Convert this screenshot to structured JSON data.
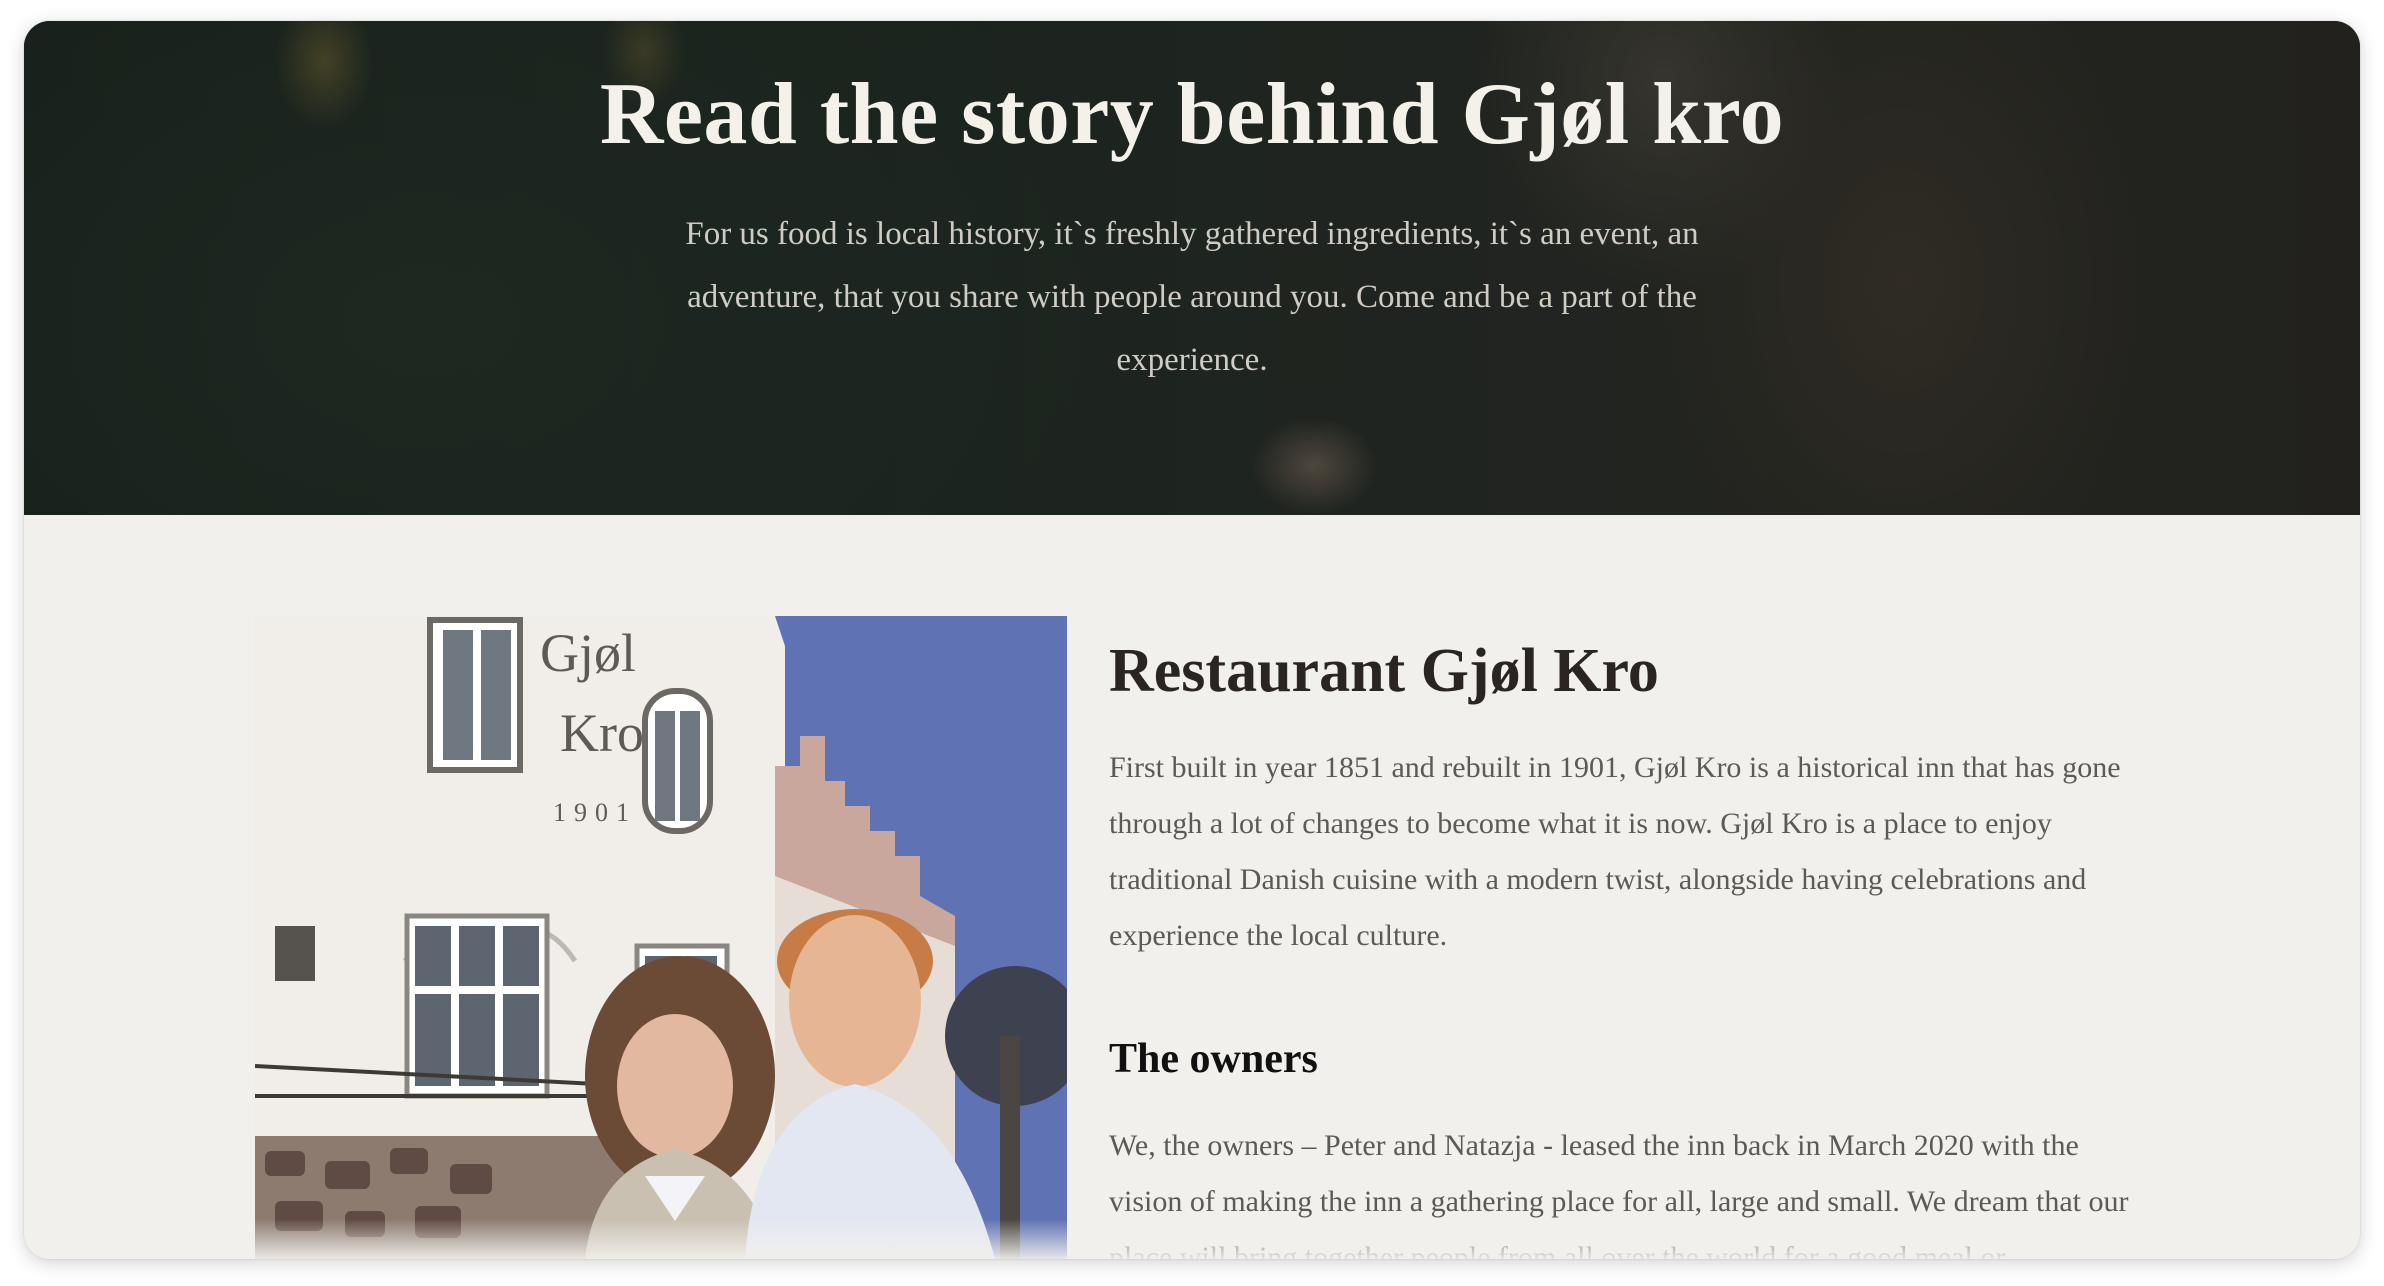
{
  "hero": {
    "title": "Read the story behind Gjøl kro",
    "text": "For us food is local history, it`s freshly gathered ingredients, it`s an event, an adventure, that you share with people around you. Come and be a part of the experience."
  },
  "about": {
    "heading": "Restaurant Gjøl Kro",
    "paragraph": "First built in year 1851 and rebuilt in 1901, Gjøl Kro is a historical inn that has gone through a lot of changes to become what it is now. Gjøl Kro is a place to enjoy traditional Danish cuisine with a modern twist, alongside having celebrations and experience the local culture.",
    "owners_heading": "The owners",
    "owners_paragraph": "We, the owners – Peter and Natazja - leased the inn back in March 2020 with the vision of making the inn a gathering place for all, large and small. We dream that our place will bring together people from all over the world for a good meal or"
  },
  "photo": {
    "sign_line1": "Gjøl",
    "sign_line2": "Kro",
    "sign_year": "1901"
  }
}
